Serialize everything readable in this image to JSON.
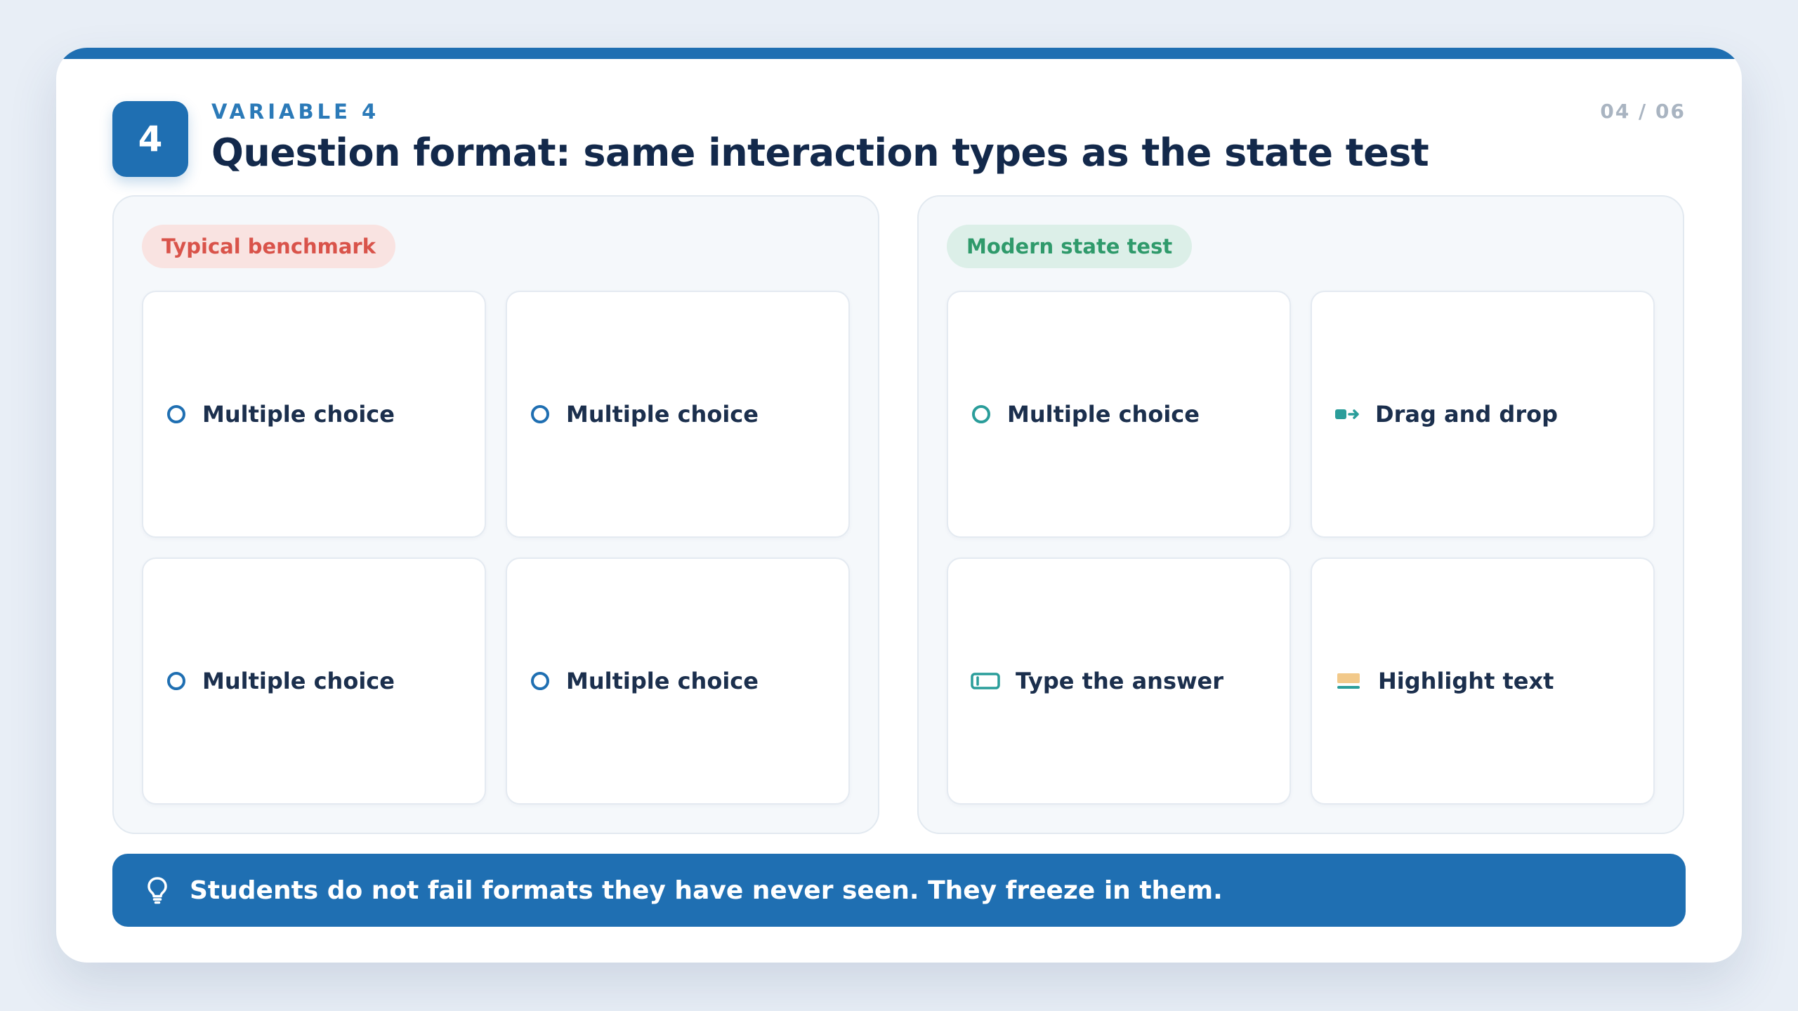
{
  "header": {
    "badge_number": "4",
    "eyebrow": "VARIABLE 4",
    "title": "Question format: same interaction types as the state test",
    "pager": "04 / 06"
  },
  "left_panel": {
    "tag": "Typical benchmark",
    "tag_color": "#d9534a",
    "tiles": [
      {
        "label": "Multiple choice",
        "icon": "radio-circle-icon"
      },
      {
        "label": "Multiple choice",
        "icon": "radio-circle-icon"
      },
      {
        "label": "Multiple choice",
        "icon": "radio-circle-icon"
      },
      {
        "label": "Multiple choice",
        "icon": "radio-circle-icon"
      }
    ]
  },
  "right_panel": {
    "tag": "Modern state test",
    "tag_color": "#2f9a6b",
    "tiles": [
      {
        "label": "Multiple choice",
        "icon": "radio-circle-icon"
      },
      {
        "label": "Drag and drop",
        "icon": "drag-drop-icon"
      },
      {
        "label": "Type the answer",
        "icon": "text-input-icon"
      },
      {
        "label": "Highlight text",
        "icon": "highlight-icon"
      }
    ]
  },
  "footer": {
    "icon": "lightbulb-icon",
    "text": "Students do not fail formats they have never seen. They freeze in them."
  },
  "colors": {
    "accent": "#1f6fb2",
    "title": "#13294b",
    "teal": "#2a9d9a",
    "highlight": "#f2c98a"
  }
}
